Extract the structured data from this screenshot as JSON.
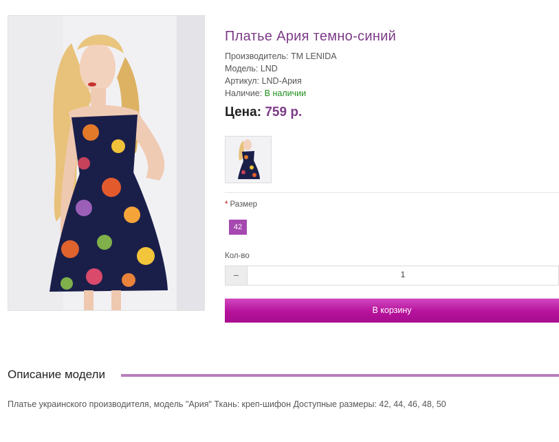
{
  "product": {
    "title": "Платье Ария темно-синий",
    "manufacturer_label": "Производитель:",
    "manufacturer": "TM LENIDA",
    "model_label": "Модель:",
    "model": "LND",
    "sku_label": "Артикул:",
    "sku": "LND-Ария",
    "availability_label": "Наличие:",
    "availability": "В наличии",
    "price_label": "Цена:",
    "price": "759 р."
  },
  "options": {
    "size_required_mark": "*",
    "size_label": "Размер",
    "size_value": "42"
  },
  "quantity": {
    "label": "Кол-во",
    "minus": "−",
    "value": "1"
  },
  "cart": {
    "button_label": "В корзину"
  },
  "description": {
    "title": "Описание модели",
    "text": "Платье украинского производителя, модель \"Ария\" Ткань: креп-шифон Доступные размеры: 42, 44, 46, 48, 50"
  },
  "colors": {
    "title": "#7c3a87",
    "accent": "#a548b0",
    "available": "#1f8f1f",
    "divider": "#b77ebb"
  }
}
